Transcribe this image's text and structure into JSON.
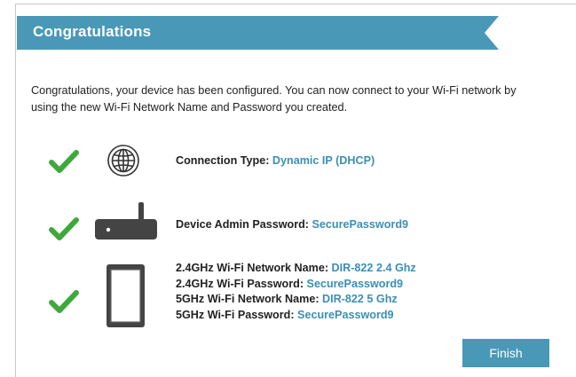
{
  "banner": {
    "title": "Congratulations"
  },
  "intro_text": "Congratulations, your device has been configured. You can now connect to your Wi-Fi network by using the new Wi-Fi Network Name and Password you created.",
  "rows": [
    {
      "icon": "globe-icon",
      "lines": [
        {
          "label": "Connection Type:",
          "value": "Dynamic IP (DHCP)"
        }
      ]
    },
    {
      "icon": "router-icon",
      "lines": [
        {
          "label": "Device Admin Password:",
          "value": "SecurePassword9"
        }
      ]
    },
    {
      "icon": "tablet-icon",
      "lines": [
        {
          "label": "2.4GHz Wi-Fi Network Name:",
          "value": "DIR-822 2.4 Ghz"
        },
        {
          "label": "2.4GHz Wi-Fi Password:",
          "value": "SecurePassword9"
        },
        {
          "label": "5GHz Wi-Fi Network Name:",
          "value": "DIR-822 5 Ghz"
        },
        {
          "label": "5GHz Wi-Fi Password:",
          "value": "SecurePassword9"
        }
      ]
    }
  ],
  "finish_label": "Finish",
  "colors": {
    "banner": "#4a98b8",
    "check": "#3fa83c",
    "value_text": "#3a8fb5",
    "button": "#4a98b8"
  }
}
